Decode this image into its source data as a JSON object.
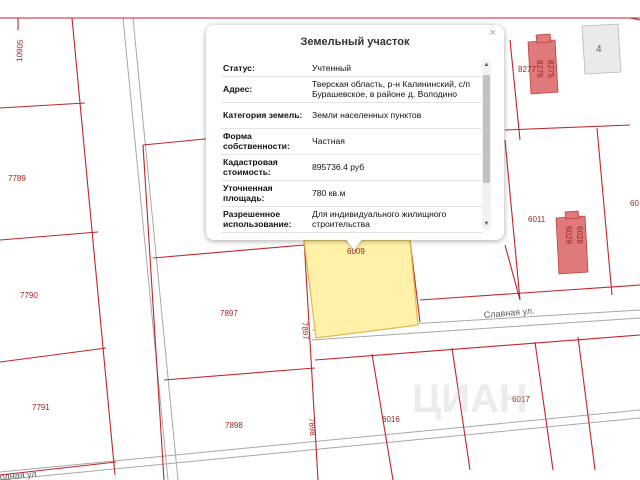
{
  "popup": {
    "title": "Земельный участок",
    "close_label": "×",
    "properties": [
      {
        "key": "Статус:",
        "value": "Учтенный"
      },
      {
        "key": "Адрес:",
        "value": "Тверская область, р-н Калининский, с/п Бурашевское, в районе д. Володино"
      },
      {
        "key": "Категория земель:",
        "value": "Земли населенных пунктов"
      },
      {
        "key": "Форма собственности:",
        "value": "Частная"
      },
      {
        "key": "Кадастровая стоимость:",
        "value": "895736.4 руб"
      },
      {
        "key": "Уточненная площадь:",
        "value": "780 кв.м"
      },
      {
        "key": "Разрешенное использование:",
        "value": "Для индивидуального жилищного строительства"
      }
    ]
  },
  "map": {
    "parcel_labels": [
      "10905",
      "7789",
      "7790",
      "7791",
      "7897",
      "7898",
      "7897",
      "7898",
      "6016",
      "6017",
      "6011",
      "6009",
      "4",
      "60"
    ],
    "building_labels": [
      "8277",
      "8276",
      "8275",
      "6029",
      "6028"
    ],
    "streets": [
      "Славная ул.",
      "одная ул"
    ],
    "watermark": "ЦИАН",
    "colors": {
      "parcel_border": "#c0262b",
      "selected_fill": "#fff2a8",
      "selected_border": "#e0b84a",
      "building": "#e07a7a",
      "road": "#9a9a9a"
    }
  }
}
